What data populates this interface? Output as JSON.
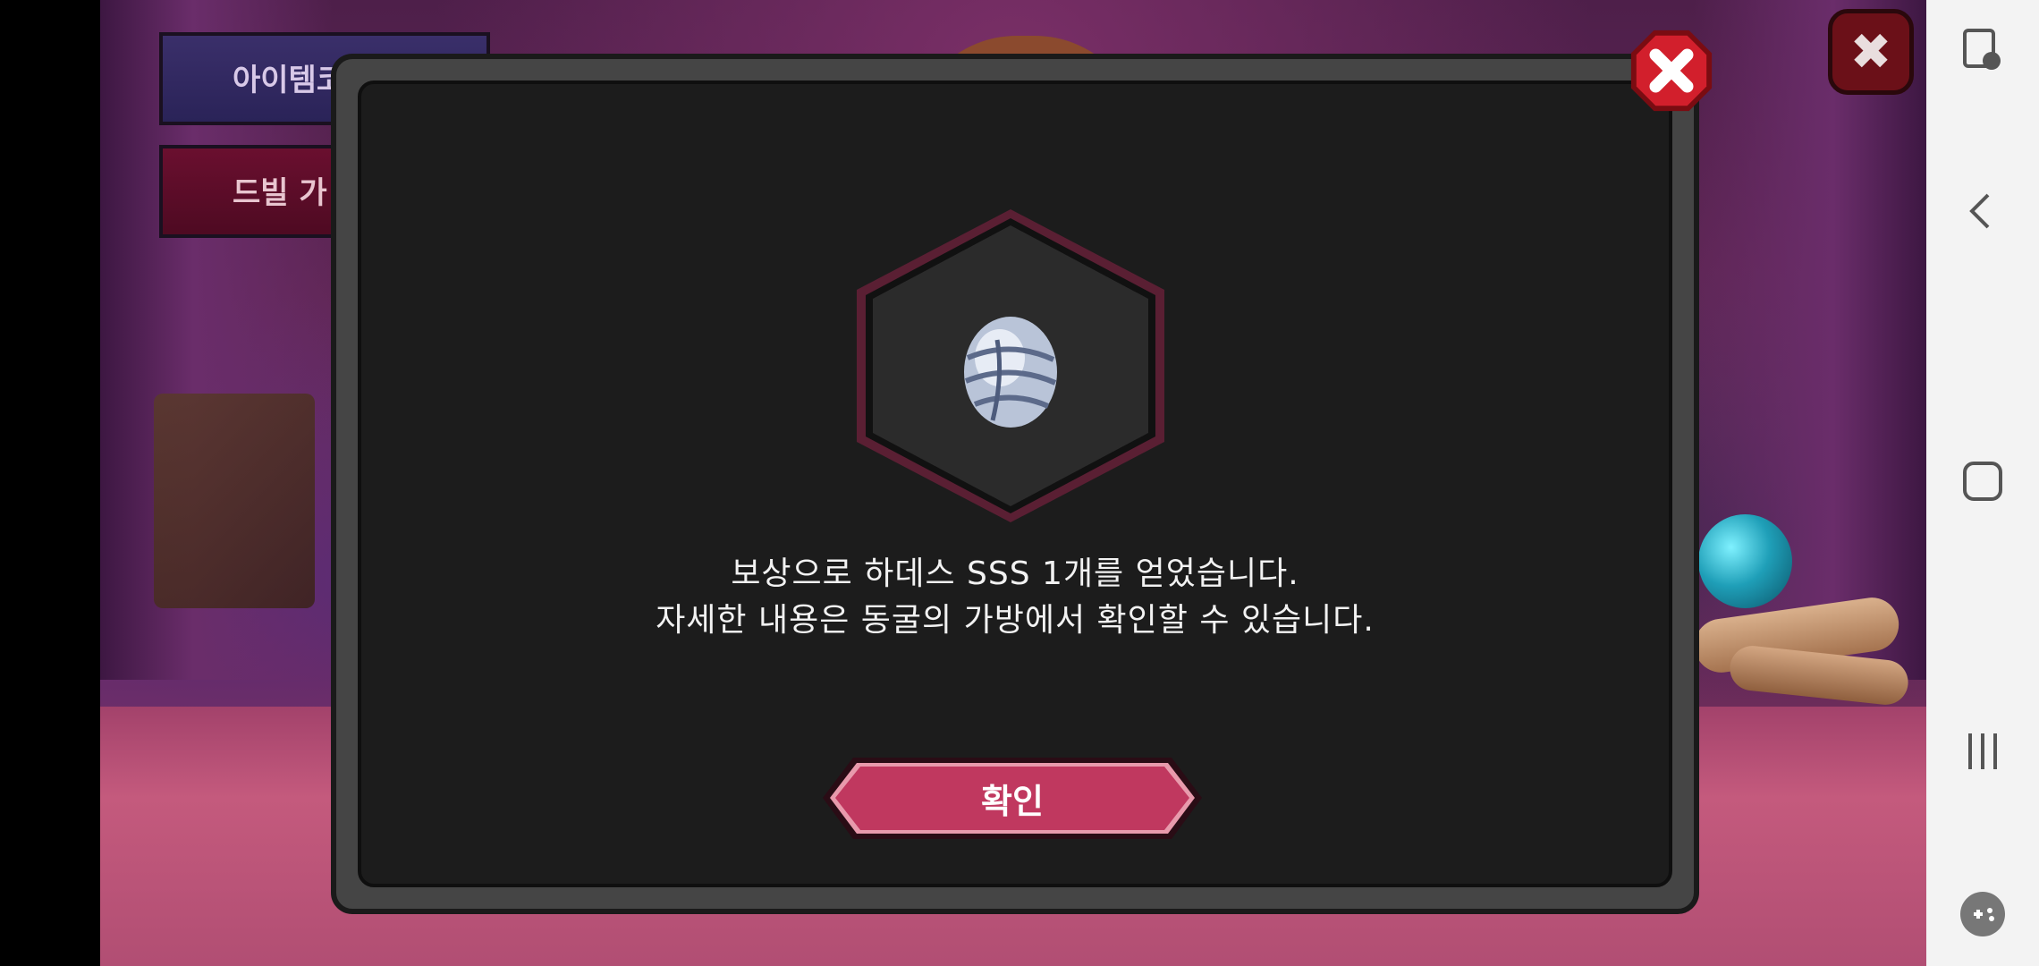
{
  "background": {
    "buttons": {
      "item_code_label": "아이템코",
      "devil_label": "드빌 가"
    }
  },
  "dialog": {
    "message_line_1": "보상으로 하데스 SSS 1개를 얻었습니다.",
    "message_line_2": "자세한 내용은 동굴의 가방에서 확인할 수 있습니다.",
    "confirm_label": "확인",
    "reward_item_icon": "egg-icon",
    "colors": {
      "confirm": "#c0385f",
      "close": "#d21f2c",
      "hex_border": "#5a1f33",
      "panel": "#1c1c1c"
    }
  },
  "nav_bar": {
    "icons": [
      "screen-touch-lock-icon",
      "back-icon",
      "home-icon",
      "recents-icon",
      "game-tools-icon"
    ]
  }
}
